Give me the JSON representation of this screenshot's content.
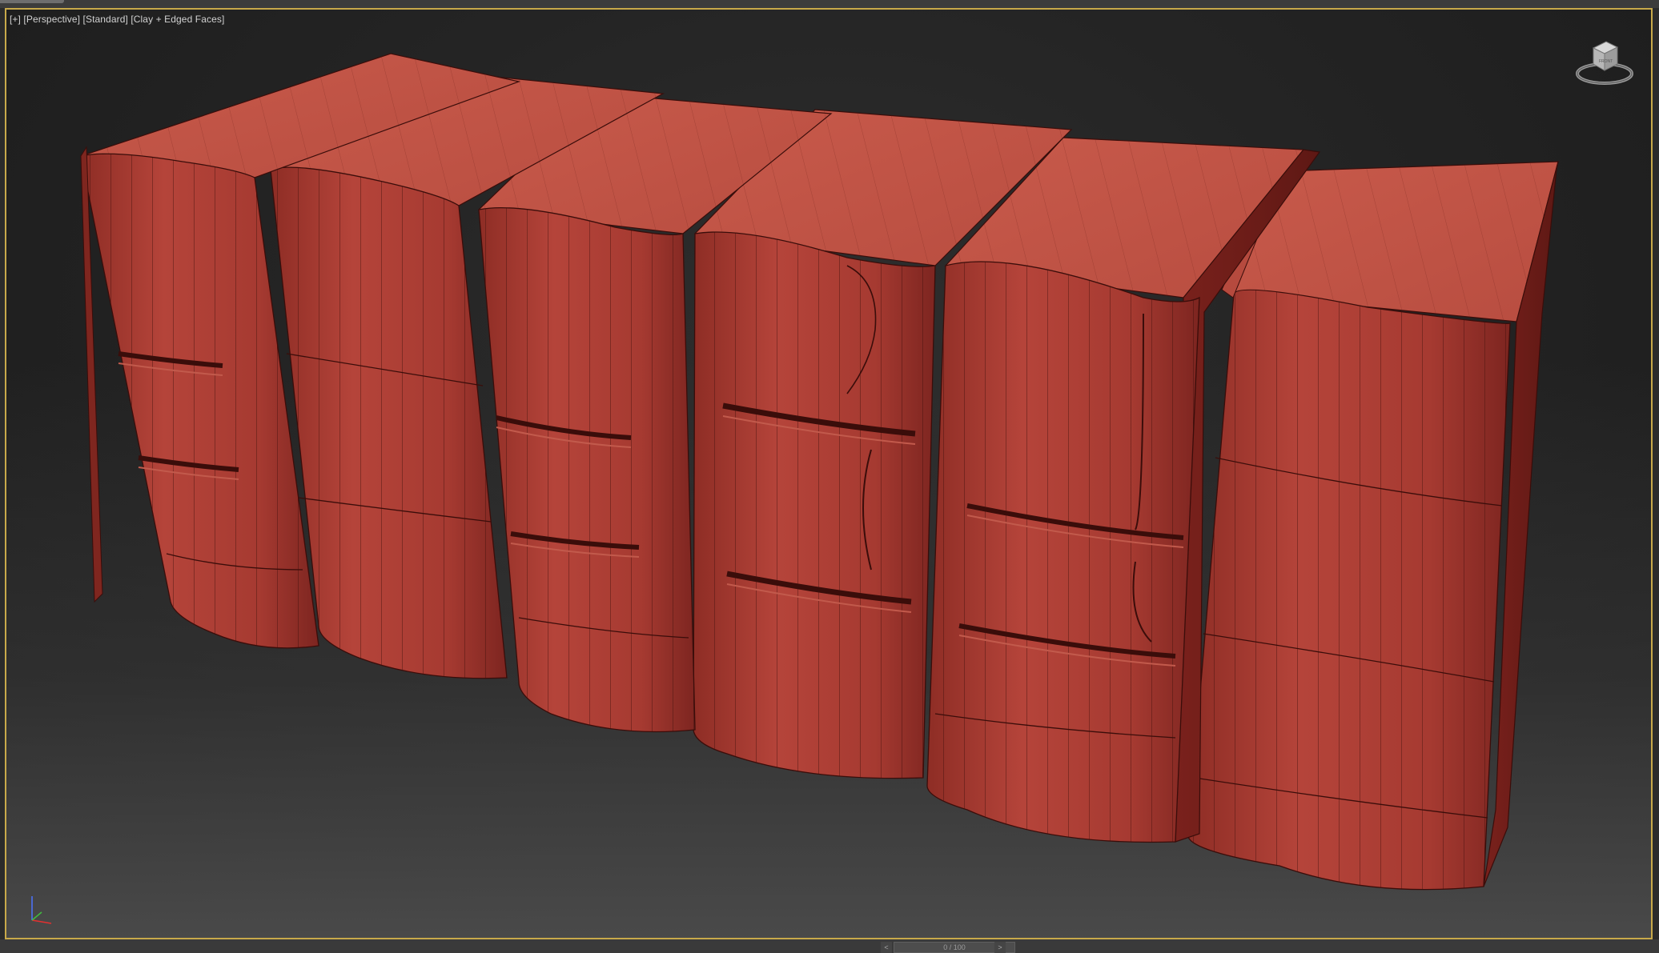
{
  "viewport": {
    "label_items": [
      "[+]",
      "[Perspective]",
      "[Standard]",
      "[Clay + Edged Faces]"
    ],
    "viewcube_label": "FRONT"
  },
  "timeslider": {
    "text": "0 / 100",
    "prev_symbol": "<",
    "next_symbol": ">"
  },
  "colors": {
    "frame_highlight": "#c8a94a",
    "clay": "#a83a30",
    "clay_top": "#c5594a",
    "background": "#2b2b2b"
  },
  "icons": [
    "viewcube-icon",
    "axis-tripod-icon"
  ]
}
